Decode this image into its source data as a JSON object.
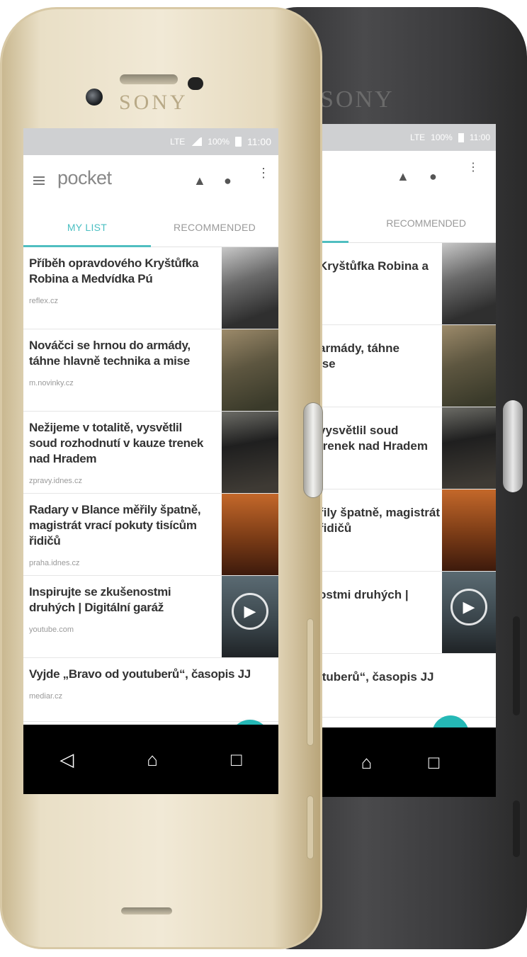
{
  "device": {
    "brand": "SONY"
  },
  "statusbar": {
    "network": "LTE",
    "battery": "100%",
    "time": "11:00"
  },
  "appbar": {
    "title": "pocket",
    "menu_icon": "menu-icon",
    "bell_icon": "bell-icon",
    "profile_icon": "person-icon",
    "more_icon": "more-vert-icon"
  },
  "tabs": [
    {
      "label": "MY LIST",
      "active": true
    },
    {
      "label": "RECOMMENDED",
      "active": false
    }
  ],
  "articles": [
    {
      "title": "Příběh opravdového Kryštůfka Robina a Medvídka Pú",
      "domain": "reflex.cz",
      "thumb": true
    },
    {
      "title": "Nováčci se hrnou do armády, táhne hlavně technika a mise",
      "domain": "m.novinky.cz",
      "thumb": true
    },
    {
      "title": "Nežijeme v totalitě, vysvětlil soud rozhodnutí v kauze trenek nad Hradem",
      "domain": "zpravy.idnes.cz",
      "thumb": true
    },
    {
      "title": "Radary v Blance měřily špatně, magistrát vrací pokuty tisícům řidičů",
      "domain": "praha.idnes.cz",
      "thumb": true
    },
    {
      "title": "Inspirujte se zkušenostmi druhých | Digitální garáž",
      "domain": "youtube.com",
      "thumb": true,
      "video": true
    },
    {
      "title": "Vyjde „Bravo od youtuberů“, časopis JJ",
      "domain": "mediar.cz",
      "thumb": false
    }
  ],
  "back_articles": [
    "Kryštůfka Robina a",
    "armády, táhne\nise",
    "vysvětlil soud\ntrenek nad Hradem",
    "řily špatně, magistrát\nřidičů",
    "ostmi druhých |",
    "ituberů“, časopis JJ"
  ],
  "fab": {
    "icon": "search-icon"
  },
  "navbar": {
    "back": "◁",
    "home": "⌂",
    "recents": "□"
  }
}
